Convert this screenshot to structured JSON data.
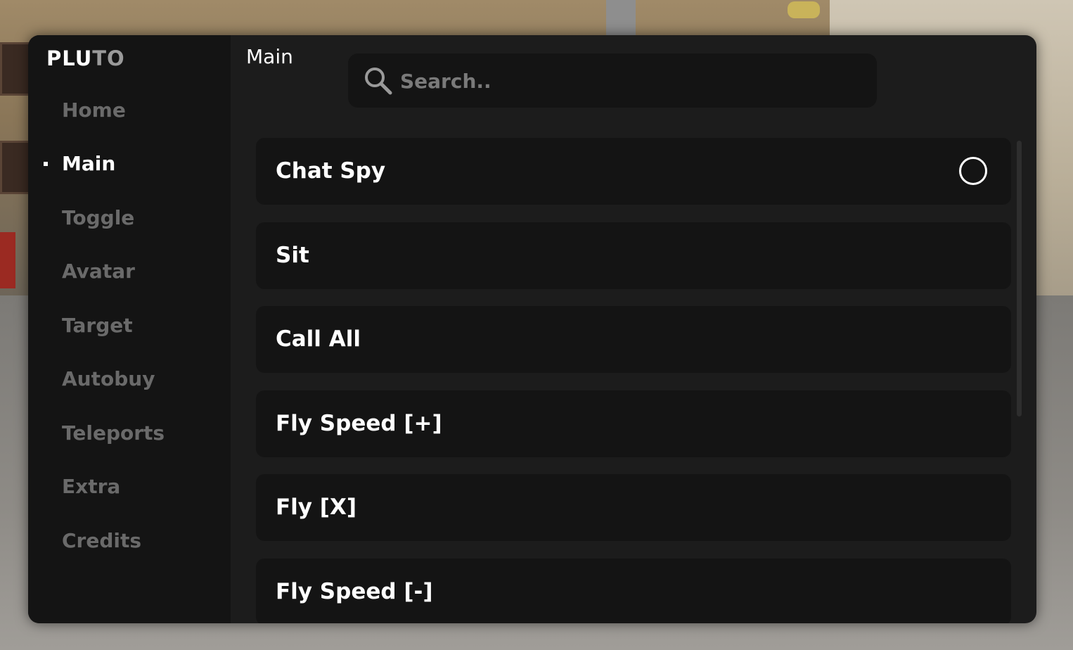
{
  "app": {
    "brand_primary": "PLU",
    "brand_secondary": "TO"
  },
  "sidebar": {
    "items": [
      {
        "label": "Home",
        "active": false
      },
      {
        "label": "Main",
        "active": true
      },
      {
        "label": "Toggle",
        "active": false
      },
      {
        "label": "Avatar",
        "active": false
      },
      {
        "label": "Target",
        "active": false
      },
      {
        "label": "Autobuy",
        "active": false
      },
      {
        "label": "Teleports",
        "active": false
      },
      {
        "label": "Extra",
        "active": false
      },
      {
        "label": "Credits",
        "active": false
      }
    ]
  },
  "main": {
    "title": "Main",
    "search": {
      "value": "",
      "placeholder": "Search.."
    },
    "rows": [
      {
        "label": "Chat Spy",
        "type": "toggle",
        "icon": "toggle-circle-icon",
        "checked": false
      },
      {
        "label": "Sit",
        "type": "button"
      },
      {
        "label": "Call All",
        "type": "button"
      },
      {
        "label": "Fly Speed [+]",
        "type": "button"
      },
      {
        "label": "Fly [X]",
        "type": "button"
      },
      {
        "label": "Fly Speed [-]",
        "type": "button"
      }
    ]
  },
  "colors": {
    "window_bg": "#1c1c1c",
    "sidebar_bg": "#141414",
    "row_bg": "#141414",
    "text_active": "#ffffff",
    "text_inactive": "#6a6a6a"
  }
}
